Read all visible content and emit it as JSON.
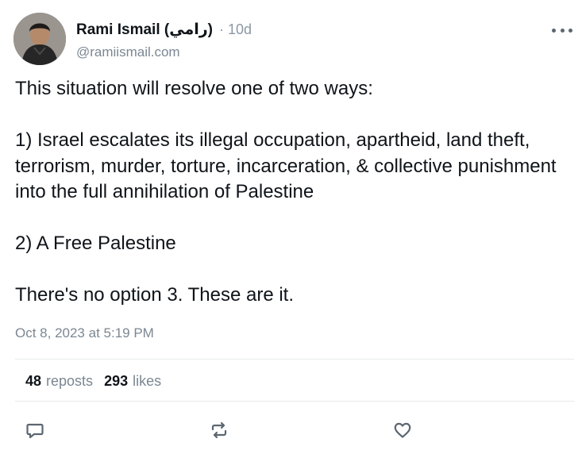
{
  "author": {
    "display_name": "Rami Ismail (رامي)",
    "separator": "·",
    "age": "10d",
    "handle": "@ramiismail.com"
  },
  "menu": {
    "icon": "more-horizontal-icon"
  },
  "post": {
    "paragraphs": [
      "This situation will resolve one of two ways:",
      "1) Israel escalates its illegal occupation, apartheid, land theft, terrorism, murder, torture, incarceration, & collective punishment into the full annihilation of Palestine",
      "2) A Free Palestine",
      "There's no option 3. These are it."
    ],
    "timestamp": "Oct 8, 2023 at 5:19 PM"
  },
  "stats": {
    "reposts_count": "48",
    "reposts_label": "reposts",
    "likes_count": "293",
    "likes_label": "likes"
  },
  "actions": {
    "reply_icon": "speech-bubble-icon",
    "repost_icon": "repost-icon",
    "like_icon": "heart-icon"
  },
  "colors": {
    "text_primary": "#0f1419",
    "text_secondary": "#7b8792",
    "divider": "#e6e9eb"
  }
}
